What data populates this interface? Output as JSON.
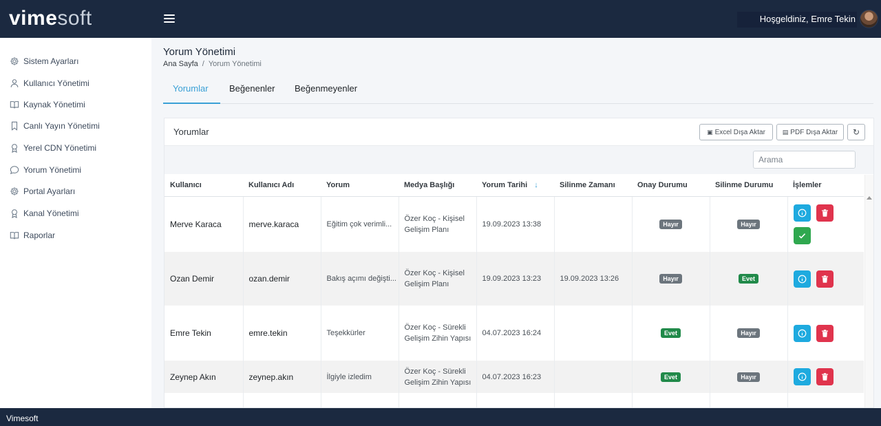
{
  "brand": {
    "logo_bold": "vime",
    "logo_light": "soft"
  },
  "header": {
    "welcome": "Hoşgeldiniz, Emre Tekin"
  },
  "sidebar": {
    "items": [
      {
        "label": "Sistem Ayarları",
        "icon": "gear-icon"
      },
      {
        "label": "Kullanıcı Yönetimi",
        "icon": "user-icon"
      },
      {
        "label": "Kaynak Yönetimi",
        "icon": "book-icon"
      },
      {
        "label": "Canlı Yayın Yönetimi",
        "icon": "bookmark-icon"
      },
      {
        "label": "Yerel CDN Yönetimi",
        "icon": "award-icon"
      },
      {
        "label": "Yorum Yönetimi",
        "icon": "chat-icon"
      },
      {
        "label": "Portal Ayarları",
        "icon": "gear-icon"
      },
      {
        "label": "Kanal Yönetimi",
        "icon": "award-icon"
      },
      {
        "label": "Raporlar",
        "icon": "book-icon"
      }
    ]
  },
  "page": {
    "title": "Yorum Yönetimi",
    "breadcrumb_home": "Ana Sayfa",
    "breadcrumb_sep": "/",
    "breadcrumb_current": "Yorum Yönetimi"
  },
  "tabs": [
    {
      "label": "Yorumlar",
      "active": true
    },
    {
      "label": "Beğenenler",
      "active": false
    },
    {
      "label": "Beğenmeyenler",
      "active": false
    }
  ],
  "card": {
    "title": "Yorumlar",
    "excel_label": "Excel Dışa Aktar",
    "pdf_label": "PDF Dışa Aktar",
    "search_placeholder": "Arama"
  },
  "table": {
    "columns": [
      "Kullanıcı",
      "Kullanıcı Adı",
      "Yorum",
      "Medya Başlığı",
      "Yorum Tarihi",
      "Silinme Zamanı",
      "Onay Durumu",
      "Silinme Durumu",
      "İşlemler"
    ],
    "sort_indicator": "↓",
    "rows": [
      {
        "user": "Merve Karaca",
        "username": "merve.karaca",
        "comment": "Eğitim çok verimli...",
        "media": "Özer Koç - Kişisel Gelişim Planı",
        "date": "19.09.2023 13:38",
        "deleted_at": "",
        "approved": "Hayır",
        "deleted": "Hayır"
      },
      {
        "user": "Ozan Demir",
        "username": "ozan.demir",
        "comment": "Bakış açımı değişti...",
        "media": "Özer Koç - Kişisel Gelişim Planı",
        "date": "19.09.2023 13:23",
        "deleted_at": "19.09.2023 13:26",
        "approved": "Hayır",
        "deleted": "Evet"
      },
      {
        "user": "Emre Tekin",
        "username": "emre.tekin",
        "comment": "Teşekkürler",
        "media": "Özer Koç - Sürekli Gelişim Zihin Yapısı",
        "date": "04.07.2023 16:24",
        "deleted_at": "",
        "approved": "Evet",
        "deleted": "Hayır"
      },
      {
        "user": "Zeynep Akın",
        "username": "zeynep.akın",
        "comment": "İlgiyle izledim",
        "media": "Özer Koç - Sürekli Gelişim Zihin Yapısı",
        "date": "04.07.2023 16:23",
        "deleted_at": "",
        "approved": "Evet",
        "deleted": "Hayır"
      }
    ]
  },
  "colors": {
    "navbar": "#1b2940",
    "accent": "#3aa0d6",
    "danger": "#e0344d",
    "info": "#1eaadf",
    "success": "#2fa84f"
  },
  "footer": {
    "text": "Vimesoft"
  }
}
